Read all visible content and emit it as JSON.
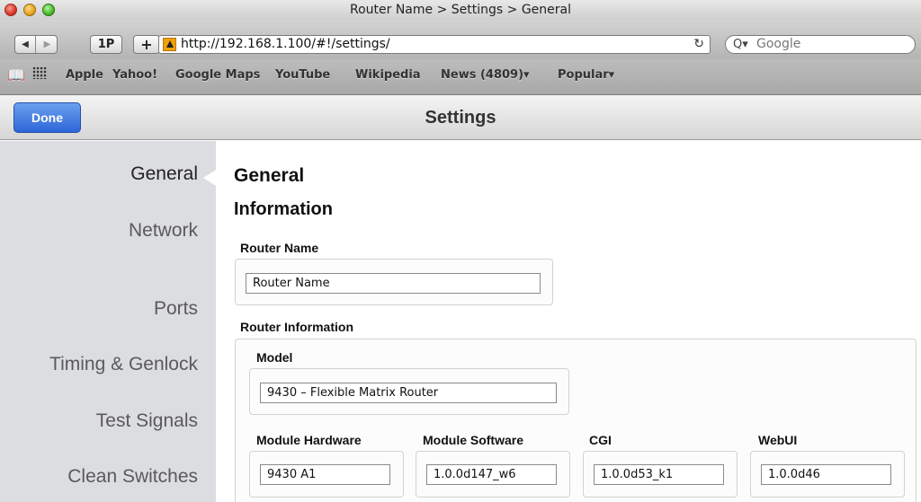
{
  "window": {
    "title": "Router Name > Settings > General"
  },
  "toolbar": {
    "back_glyph": "◀",
    "forward_glyph": "▶",
    "onep_label": "1P",
    "plus_label": "+",
    "url": "http://192.168.1.100/#!/settings/",
    "reload_glyph": "↻",
    "search_icon_glyph": "Q▾",
    "search_placeholder": "Google"
  },
  "bookmarks": {
    "reading_glyph": "📖",
    "items": [
      "Apple",
      "Yahoo!",
      "Google Maps",
      "YouTube",
      "Wikipedia",
      "News (4809)▾",
      "Popular▾"
    ]
  },
  "header": {
    "done_label": "Done",
    "title": "Settings"
  },
  "sidebar": {
    "items": [
      "General",
      "Network",
      "Ports",
      "Timing & Genlock",
      "Test Signals",
      "Clean Switches"
    ],
    "selected": "General"
  },
  "main": {
    "page_title": "General",
    "section_title": "Information",
    "router_name": {
      "label": "Router Name",
      "value": "Router Name"
    },
    "router_info": {
      "label": "Router Information",
      "model": {
        "label": "Model",
        "value": "9430 – Flexible Matrix Router"
      },
      "module_hardware": {
        "label": "Module Hardware",
        "value": "9430 A1"
      },
      "module_software": {
        "label": "Module Software",
        "value": "1.0.0d147_w6"
      },
      "cgi": {
        "label": "CGI",
        "value": "1.0.0d53_k1"
      },
      "webui": {
        "label": "WebUI",
        "value": "1.0.0d46"
      }
    }
  },
  "colors": {
    "accent": "#2e66d8",
    "sidebar_bg": "#dcdde1"
  }
}
